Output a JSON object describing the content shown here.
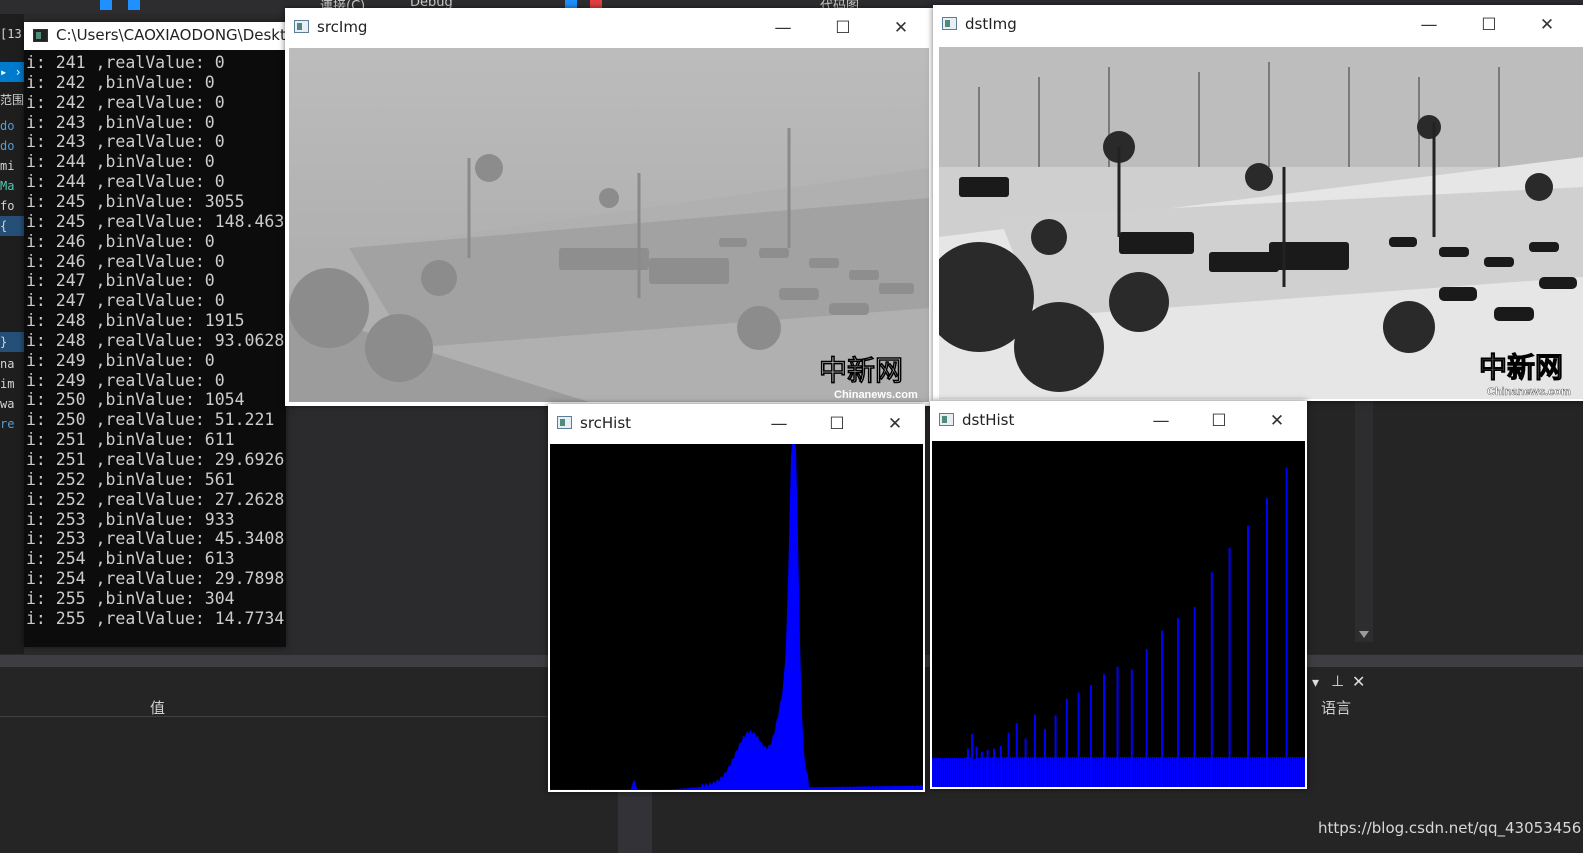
{
  "vs": {
    "toolbar_items": [
      "連接(C)",
      "Debug",
      "代码图"
    ],
    "left_lines": [
      "[13",
      "▸ ›",
      "范围)",
      "do",
      "do",
      "mi",
      "Ma",
      "fo",
      "{",
      "}",
      "na",
      "im",
      "wa",
      "re"
    ],
    "left_line_colors": [
      "#d4d4d4",
      "#ffffff",
      "#d4d4d4",
      "#569cd6",
      "#569cd6",
      "#d4d4d4",
      "#4ec9b0",
      "#d4d4d4",
      "#d4d4d4",
      "#d4d4d4",
      "#d4d4d4",
      "#d4d4d4",
      "#d4d4d4",
      "#569cd6"
    ],
    "bottom_col_label": "值",
    "right_col_label": "语言",
    "url": "https://blog.csdn.net/qq_43053456"
  },
  "console": {
    "title": "C:\\Users\\CAOXIAODONG\\Deskt",
    "lines": [
      "i: 241 ,realValue: 0",
      "i: 242 ,binValue: 0",
      "i: 242 ,realValue: 0",
      "i: 243 ,binValue: 0",
      "i: 243 ,realValue: 0",
      "i: 244 ,binValue: 0",
      "i: 244 ,realValue: 0",
      "i: 245 ,binValue: 3055",
      "i: 245 ,realValue: 148.463",
      "i: 246 ,binValue: 0",
      "i: 246 ,realValue: 0",
      "i: 247 ,binValue: 0",
      "i: 247 ,realValue: 0",
      "i: 248 ,binValue: 1915",
      "i: 248 ,realValue: 93.0628",
      "i: 249 ,binValue: 0",
      "i: 249 ,realValue: 0",
      "i: 250 ,binValue: 1054",
      "i: 250 ,realValue: 51.221",
      "i: 251 ,binValue: 611",
      "i: 251 ,realValue: 29.6926",
      "i: 252 ,binValue: 561",
      "i: 252 ,realValue: 27.2628",
      "i: 253 ,binValue: 933",
      "i: 253 ,realValue: 45.3408",
      "i: 254 ,binValue: 613",
      "i: 254 ,realValue: 29.7898",
      "i: 255 ,binValue: 304",
      "i: 255 ,realValue: 14.7734"
    ]
  },
  "windows": {
    "srcImg": {
      "title": "srcImg"
    },
    "dstImg": {
      "title": "dstImg"
    },
    "srcHist": {
      "title": "srcHist"
    },
    "dstHist": {
      "title": "dstHist"
    },
    "controls": {
      "minimize": "—",
      "maximize": "☐",
      "close": "✕"
    }
  },
  "images": {
    "watermark": "中新网",
    "watermark_sub": "Chinanews.com"
  },
  "hist_color": "#0000ff"
}
